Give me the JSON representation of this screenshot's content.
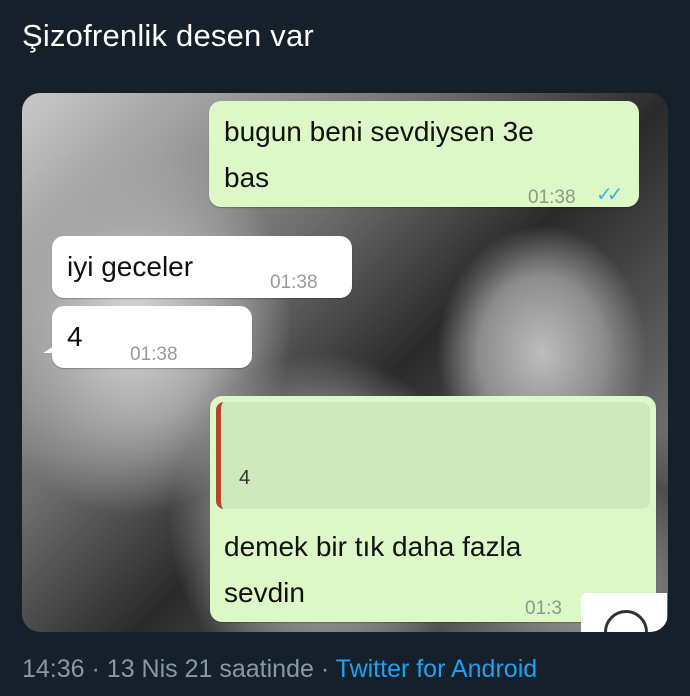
{
  "tweet": {
    "text": "Şizofrenlik desen var",
    "time": "14:36",
    "separator": "·",
    "date": "13 Nis 21 saatinde",
    "source": "Twitter for Android",
    "source_color": "#1da1f2"
  },
  "chat": {
    "messages": [
      {
        "direction": "outgoing",
        "line1": "bugun beni sevdiysen 3e",
        "line2": "bas",
        "time": "01:38",
        "status": "double-check-icon"
      },
      {
        "direction": "incoming",
        "text": "iyi geceler",
        "time": "01:38"
      },
      {
        "direction": "incoming",
        "text": "4",
        "time": "01:38"
      },
      {
        "direction": "outgoing",
        "quoted": "4",
        "line1": "demek bir tık daha fazla",
        "line2": "sevdin",
        "time": "01:3"
      }
    ],
    "outgoing_color": "#dcf8c6",
    "incoming_color": "#ffffff",
    "tick_color": "#34b7f1"
  }
}
